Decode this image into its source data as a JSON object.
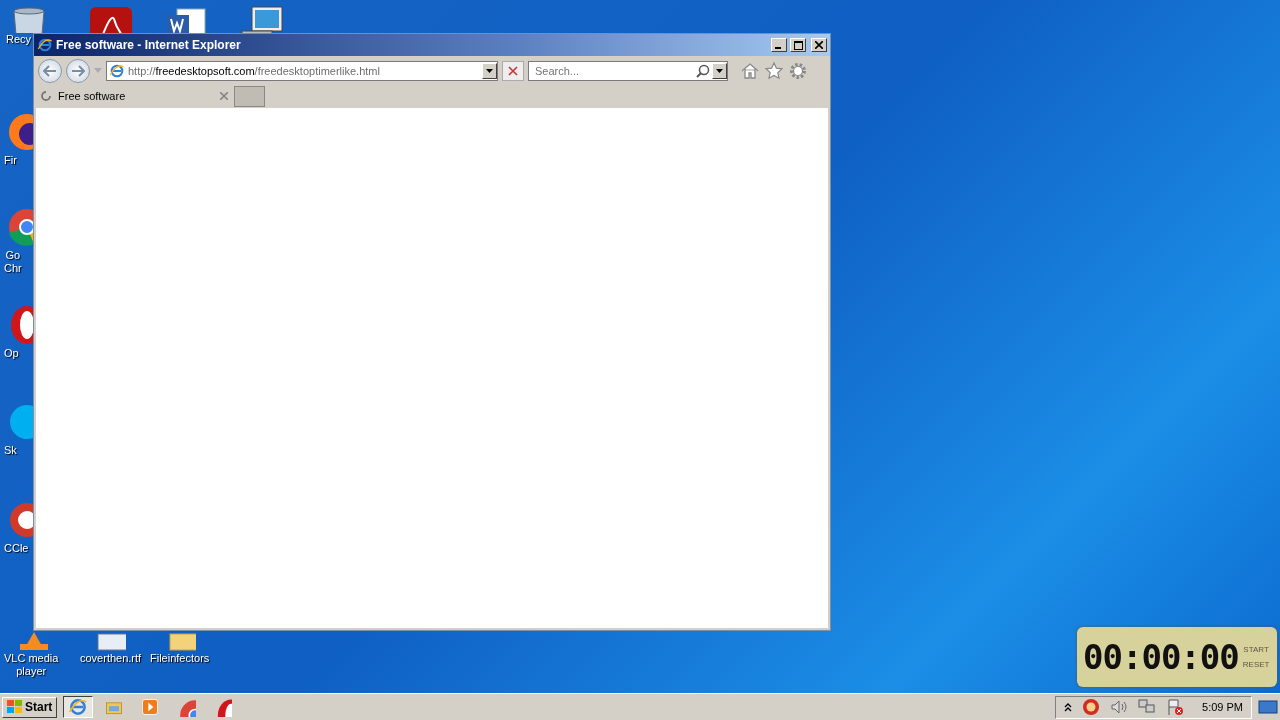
{
  "desktop_icons": [
    {
      "kind": "recycle",
      "label": [
        "Recy"
      ]
    },
    {
      "kind": "pdf"
    },
    {
      "kind": "word"
    },
    {
      "kind": "computer"
    },
    {
      "kind": "firefox",
      "label": [
        "Fir"
      ]
    },
    {
      "kind": "chrome",
      "label": [
        "Go",
        "Chr"
      ]
    },
    {
      "kind": "opera",
      "label": [
        "Op"
      ]
    },
    {
      "kind": "skype",
      "label": [
        "Sk"
      ]
    },
    {
      "kind": "ccleaner",
      "label": [
        "CCle"
      ]
    },
    {
      "kind": "vlc",
      "label": [
        "VLC media",
        "player"
      ]
    },
    {
      "kind": "document",
      "label": [
        "coverthen.rtf"
      ]
    },
    {
      "kind": "folder",
      "label": [
        "Fileinfectors"
      ]
    }
  ],
  "window": {
    "title": "Free software - Internet Explorer",
    "address": {
      "scheme": "http://",
      "host": "freedesktopsoft.com",
      "path": "/freedesktoptimerlike.html"
    },
    "search": {
      "placeholder": "Search..."
    },
    "tabs": [
      {
        "label": "Free software",
        "selected": true,
        "loading": true
      }
    ]
  },
  "timer_widget": {
    "display": "00:00:00",
    "start": "START",
    "reset": "RESET"
  },
  "taskbar": {
    "start": "Start",
    "items": [
      {
        "kind": "ie",
        "selected": true
      },
      {
        "kind": "explorer",
        "selected": false
      },
      {
        "kind": "media",
        "selected": false
      },
      {
        "kind": "chrome",
        "selected": false
      },
      {
        "kind": "opera",
        "selected": false
      }
    ],
    "clock": "5:09 PM"
  }
}
